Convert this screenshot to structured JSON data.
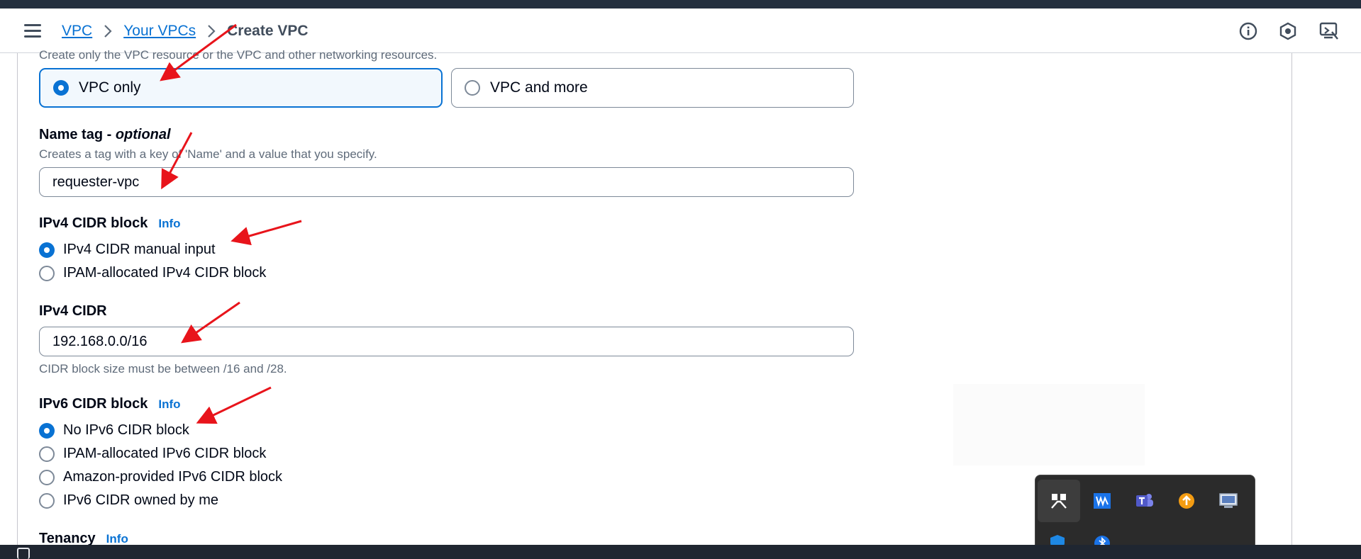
{
  "breadcrumb": {
    "items": [
      "VPC",
      "Your VPCs"
    ],
    "current": "Create VPC"
  },
  "resources": {
    "description": "Create only the VPC resource or the VPC and other networking resources.",
    "options": [
      "VPC only",
      "VPC and more"
    ],
    "selected": "VPC only"
  },
  "name_tag": {
    "label": "Name tag",
    "separator": " - ",
    "optional": "optional",
    "description": "Creates a tag with a key of 'Name' and a value that you specify.",
    "value": "requester-vpc"
  },
  "ipv4_block": {
    "label": "IPv4 CIDR block",
    "info": "Info",
    "options": [
      "IPv4 CIDR manual input",
      "IPAM-allocated IPv4 CIDR block"
    ],
    "selected": "IPv4 CIDR manual input"
  },
  "ipv4_cidr": {
    "label": "IPv4 CIDR",
    "value": "192.168.0.0/16",
    "hint": "CIDR block size must be between /16 and /28."
  },
  "ipv6_block": {
    "label": "IPv6 CIDR block",
    "info": "Info",
    "options": [
      "No IPv6 CIDR block",
      "IPAM-allocated IPv6 CIDR block",
      "Amazon-provided IPv6 CIDR block",
      "IPv6 CIDR owned by me"
    ],
    "selected": "No IPv6 CIDR block"
  },
  "tenancy": {
    "label": "Tenancy",
    "info": "Info"
  },
  "header_icons": [
    "info-icon",
    "settings-icon",
    "feedback-icon"
  ],
  "tray_icons": [
    "snip-icon",
    "audio-icon",
    "teams-icon",
    "update-icon",
    "display-icon",
    "defender-icon",
    "bluetooth-icon"
  ],
  "colors": {
    "accent": "#0972d3",
    "annotation": "#e8141b",
    "header_dark": "#232f3e"
  }
}
